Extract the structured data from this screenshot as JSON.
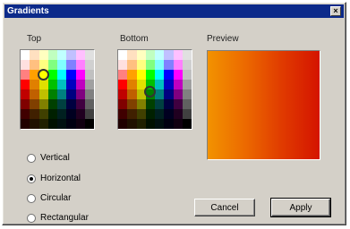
{
  "window": {
    "title": "Gradients",
    "close_symbol": "×"
  },
  "top_palette": {
    "label": "Top",
    "selected_color": "#e0a000"
  },
  "bottom_palette": {
    "label": "Bottom",
    "selected_color": "#c80000"
  },
  "preview": {
    "label": "Preview",
    "gradient_colors": [
      "#f29200",
      "#ec6a00",
      "#e03a00",
      "#d41400"
    ]
  },
  "orientation": {
    "options": [
      {
        "label": "Vertical",
        "selected": false
      },
      {
        "label": "Horizontal",
        "selected": true
      },
      {
        "label": "Circular",
        "selected": false
      },
      {
        "label": "Rectangular",
        "selected": false
      }
    ]
  },
  "buttons": {
    "cancel": "Cancel",
    "apply": "Apply"
  },
  "palette_colors": [
    [
      "#ffffff",
      "#ffe0c0",
      "#ffffc0",
      "#c0ffc0",
      "#c0ffff",
      "#c0c0ff",
      "#ffc0ff",
      "#e0e0e0"
    ],
    [
      "#ffe0e0",
      "#ffc080",
      "#ffff80",
      "#80ff80",
      "#80ffff",
      "#8080ff",
      "#ff80ff",
      "#d0d0d0"
    ],
    [
      "#ff8080",
      "#ffa000",
      "#ffff00",
      "#00ff00",
      "#00ffff",
      "#0000ff",
      "#ff00ff",
      "#c0c0c0"
    ],
    [
      "#ff0000",
      "#e08000",
      "#e0e000",
      "#00c000",
      "#00c0c0",
      "#0000c0",
      "#c000c0",
      "#a0a0a0"
    ],
    [
      "#c00000",
      "#c06000",
      "#c0c000",
      "#008000",
      "#008080",
      "#000080",
      "#800080",
      "#808080"
    ],
    [
      "#800000",
      "#804000",
      "#808000",
      "#004000",
      "#004040",
      "#000040",
      "#400040",
      "#606060"
    ],
    [
      "#400000",
      "#402000",
      "#404000",
      "#002000",
      "#002020",
      "#000020",
      "#200020",
      "#404040"
    ],
    [
      "#200000",
      "#201000",
      "#202000",
      "#001000",
      "#001010",
      "#000010",
      "#100010",
      "#000000"
    ]
  ]
}
